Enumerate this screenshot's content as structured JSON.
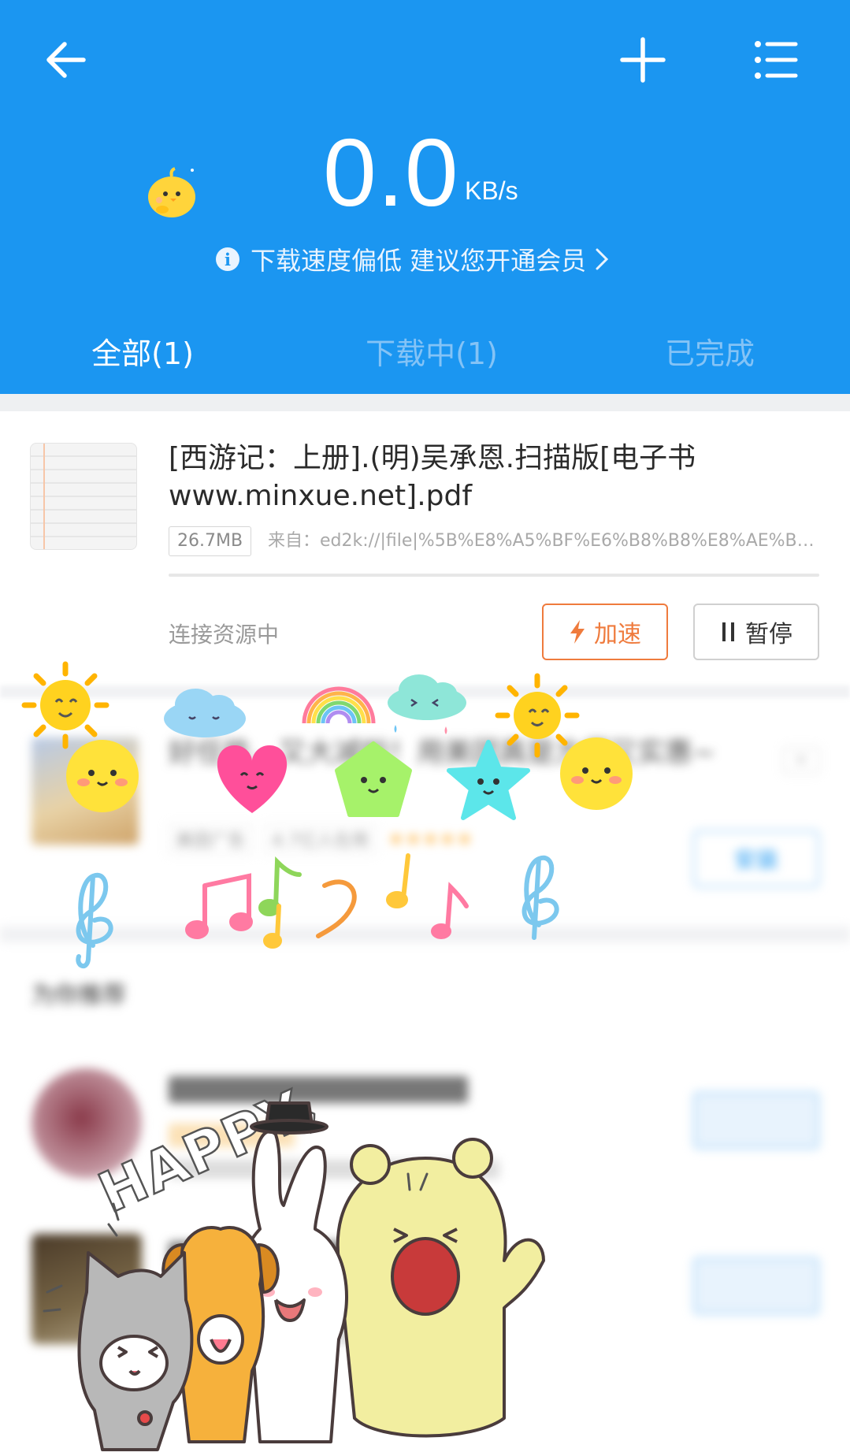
{
  "colors": {
    "primary": "#1b96f1",
    "accent": "#ef7b3d"
  },
  "header": {
    "back_icon": "arrow-left-icon",
    "add_icon": "plus-icon",
    "menu_icon": "list-menu-icon",
    "speed_value": "0.0",
    "speed_unit": "KB/s",
    "hint_text": "下载速度偏低 建议您开通会员"
  },
  "tabs": [
    {
      "label": "全部(1)",
      "active": true
    },
    {
      "label": "下载中(1)",
      "active": false
    },
    {
      "label": "已完成",
      "active": false
    }
  ],
  "task": {
    "file_name": "[西游记：上册].(明)吴承恩.扫描版[电子书www.minxue.net].pdf",
    "size": "26.7MB",
    "source": "来自：ed2k://|file|%5B%E8%A5%BF%E6%B8%B8%E8%AE%B0%..",
    "progress": 0.0,
    "status": "连接资源中",
    "speedup_label": "加速",
    "pause_label": "暂停"
  },
  "ad": {
    "title": "好任性，又大减啦！用美团真是方便又实惠~",
    "tag": "美团广告",
    "users": "4.7亿人在用",
    "stars": "★★★★★",
    "close_label": "×",
    "install_label": "安装"
  },
  "section": {
    "title": "为你推荐"
  }
}
